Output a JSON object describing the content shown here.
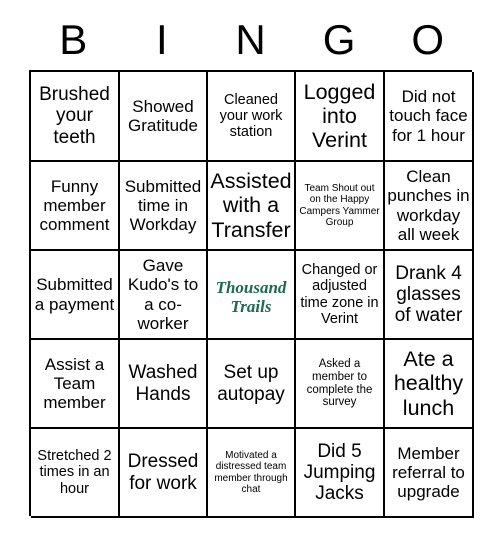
{
  "header": {
    "letters": [
      "B",
      "I",
      "N",
      "G",
      "O"
    ]
  },
  "grid": {
    "rows": 5,
    "columns": 5,
    "cells": [
      {
        "text": "Brushed your teeth",
        "size": "lg"
      },
      {
        "text": "Showed Gratitude",
        "size": "md"
      },
      {
        "text": "Cleaned your work station",
        "size": "sm"
      },
      {
        "text": "Logged into Verint",
        "size": "xl"
      },
      {
        "text": "Did not touch face for 1 hour",
        "size": "md"
      },
      {
        "text": "Funny member comment",
        "size": "md"
      },
      {
        "text": "Submitted time in Workday",
        "size": "md"
      },
      {
        "text": "Assisted with a Transfer",
        "size": "xl"
      },
      {
        "text": "Team Shout out on the Happy Campers Yammer Group",
        "size": "xxs"
      },
      {
        "text": "Clean punches in workday all week",
        "size": "md"
      },
      {
        "text": "Submitted a payment",
        "size": "md"
      },
      {
        "text": "Gave Kudo's to a co-worker",
        "size": "md"
      },
      {
        "text": "Thousand Trails",
        "size": "logo",
        "is_logo": true,
        "color": "#1a6b52"
      },
      {
        "text": "Changed or adjusted time zone in Verint",
        "size": "sm"
      },
      {
        "text": "Drank 4 glasses of water",
        "size": "lg"
      },
      {
        "text": "Assist a Team member",
        "size": "md"
      },
      {
        "text": "Washed Hands",
        "size": "lg"
      },
      {
        "text": "Set up autopay",
        "size": "lg"
      },
      {
        "text": "Asked a member to complete the survey",
        "size": "xs"
      },
      {
        "text": "Ate a healthy lunch",
        "size": "xl"
      },
      {
        "text": "Stretched 2 times in an hour",
        "size": "sm"
      },
      {
        "text": "Dressed for work",
        "size": "lg"
      },
      {
        "text": "Motivated a distressed team member through chat",
        "size": "xxs"
      },
      {
        "text": "Did 5 Jumping Jacks",
        "size": "lg"
      },
      {
        "text": "Member referral to upgrade",
        "size": "md"
      }
    ]
  }
}
